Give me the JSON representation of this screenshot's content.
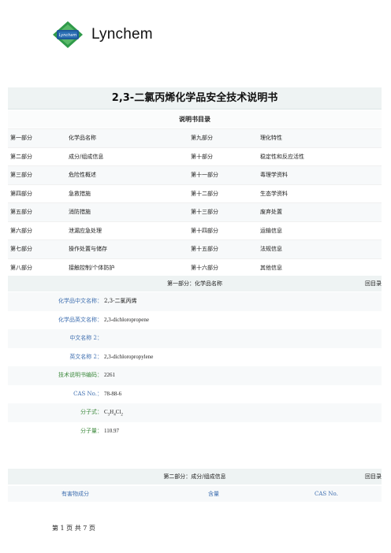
{
  "brand": {
    "name": "Lynchem",
    "logo_text": "Lynchem"
  },
  "document": {
    "title": "2,3-二氯丙烯化学品安全技术说明书"
  },
  "toc": {
    "header": "说明书目录",
    "rows": [
      {
        "p1": "第一部分",
        "n1": "化学品名称",
        "p2": "第九部分",
        "n2": "理化特性"
      },
      {
        "p1": "第二部分",
        "n1": "成分/组成信息",
        "p2": "第十部分",
        "n2": "稳定性和反应活性"
      },
      {
        "p1": "第三部分",
        "n1": "危险性概述",
        "p2": "第十一部分",
        "n2": "毒理学资料"
      },
      {
        "p1": "第四部分",
        "n1": "急救措施",
        "p2": "第十二部分",
        "n2": "生态学资料"
      },
      {
        "p1": "第五部分",
        "n1": "消防措施",
        "p2": "第十三部分",
        "n2": "废弃处置"
      },
      {
        "p1": "第六部分",
        "n1": "泄漏应急处理",
        "p2": "第十四部分",
        "n2": "运输信息"
      },
      {
        "p1": "第七部分",
        "n1": "操作处置与储存",
        "p2": "第十五部分",
        "n2": "法规信息"
      },
      {
        "p1": "第八部分",
        "n1": "接触控制/个体防护",
        "p2": "第十六部分",
        "n2": "其他信息"
      }
    ]
  },
  "section1": {
    "title": "第一部分：化学品名称",
    "back": "回目录",
    "fields": [
      {
        "label": "化学品中文名称：",
        "value": "2,3-二氯丙烯"
      },
      {
        "label": "化学品英文名称：",
        "value": "2,3-dichloropropene"
      },
      {
        "label": "中文名称 2：",
        "value": ""
      },
      {
        "label": "英文名称 2：",
        "value": "2,3-dichloropropylene"
      },
      {
        "label": "技术说明书编码：",
        "value": "2261"
      },
      {
        "label": "CAS No.：",
        "value": "78-88-6"
      },
      {
        "label": "分子式：",
        "value": "C3H4Cl2"
      },
      {
        "label": "分子量：",
        "value": "110.97"
      }
    ]
  },
  "section2": {
    "title": "第二部分：成分/组成信息",
    "back": "回目录",
    "columns": [
      "有害物成分",
      "含量",
      "CAS No."
    ]
  },
  "footer": {
    "text": "第 1 页 共 7 页"
  }
}
